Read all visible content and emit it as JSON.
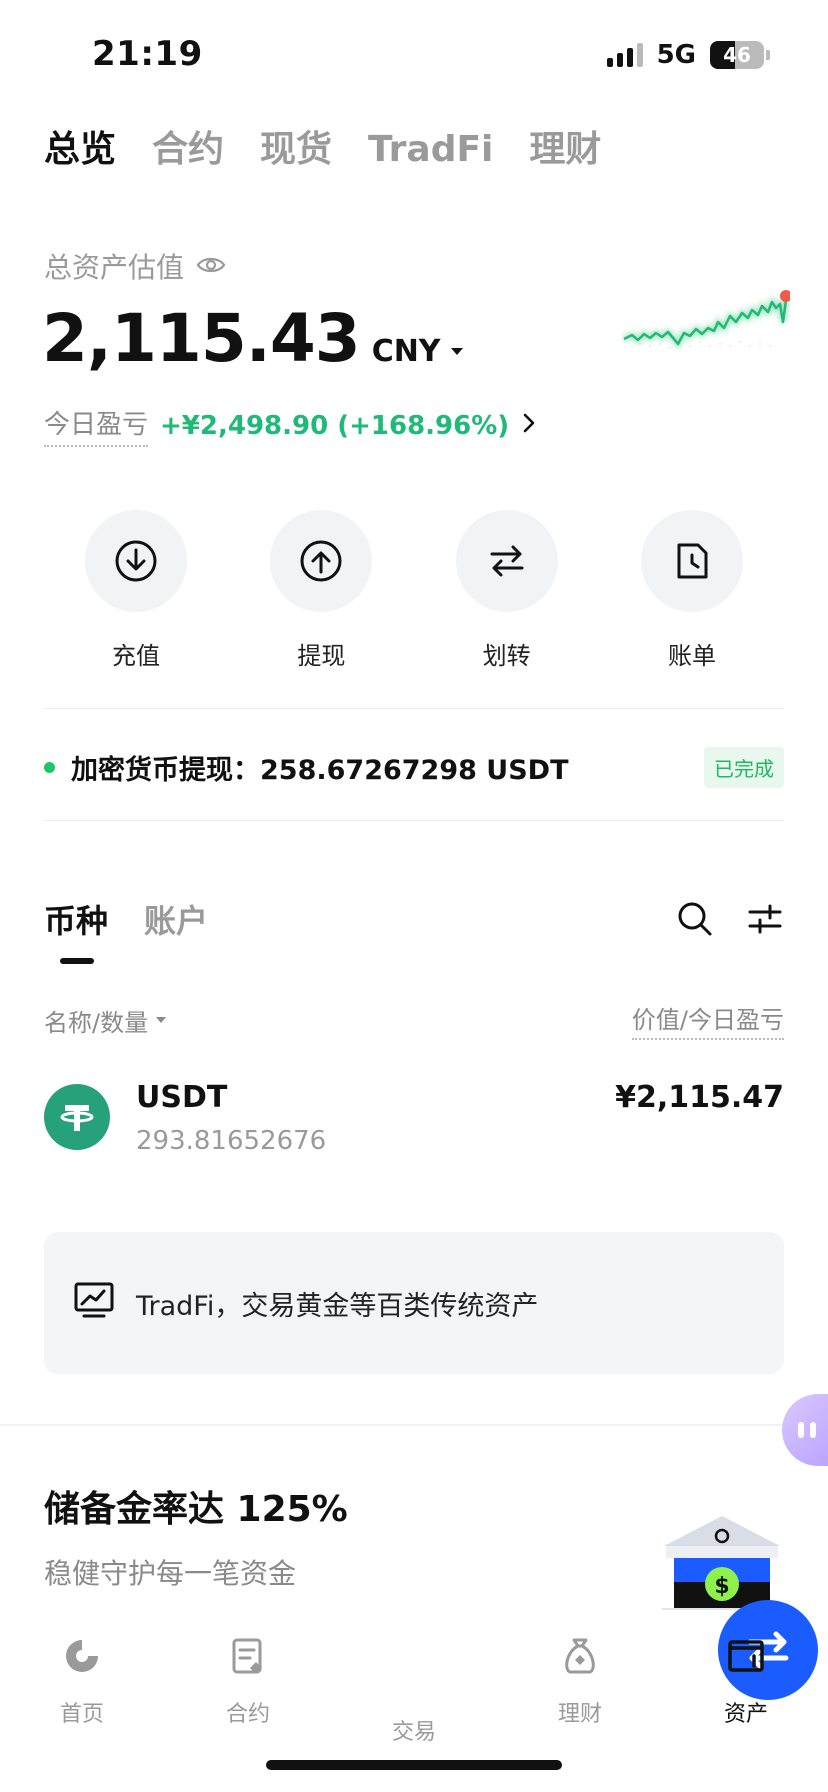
{
  "status_bar": {
    "time": "21:19",
    "network": "5G",
    "battery": "46",
    "battery_level": 0.46
  },
  "top_tabs": [
    {
      "label": "总览",
      "active": true
    },
    {
      "label": "合约",
      "active": false
    },
    {
      "label": "现货",
      "active": false
    },
    {
      "label": "TradFi",
      "active": false
    },
    {
      "label": "理财",
      "active": false
    }
  ],
  "balance": {
    "label": "总资产估值",
    "value": "2,115.43",
    "currency": "CNY",
    "pnl_label": "今日盈亏",
    "pnl_value": "+¥2,498.90 (+168.96%)"
  },
  "colors": {
    "positive": "#1fb978",
    "accent": "#1a5cff",
    "usdt": "#26a17b"
  },
  "actions": [
    {
      "label": "充值",
      "icon": "download-icon"
    },
    {
      "label": "提现",
      "icon": "upload-icon"
    },
    {
      "label": "划转",
      "icon": "transfer-icon"
    },
    {
      "label": "账单",
      "icon": "bill-icon"
    }
  ],
  "notice": {
    "text": "加密货币提现：258.67267298 USDT",
    "status": "已完成"
  },
  "asset_tabs": [
    {
      "label": "币种",
      "active": true
    },
    {
      "label": "账户",
      "active": false
    }
  ],
  "list_header": {
    "left": "名称/数量",
    "right": "价值/今日盈亏"
  },
  "assets": [
    {
      "name": "USDT",
      "quantity": "293.81652676",
      "value": "¥2,115.47"
    }
  ],
  "promo": {
    "text": "TradFi，交易黄金等百类传统资产"
  },
  "reserve": {
    "title": "储备金率达 125%",
    "subtitle": "稳健守护每一笔资金"
  },
  "bottom_nav": [
    {
      "label": "首页",
      "icon": "home-icon",
      "active": false
    },
    {
      "label": "合约",
      "icon": "contract-icon",
      "active": false
    },
    {
      "label": "交易",
      "icon": "trade-icon",
      "active": false
    },
    {
      "label": "理财",
      "icon": "wealth-icon",
      "active": false
    },
    {
      "label": "资产",
      "icon": "wallet-icon",
      "active": true
    }
  ]
}
